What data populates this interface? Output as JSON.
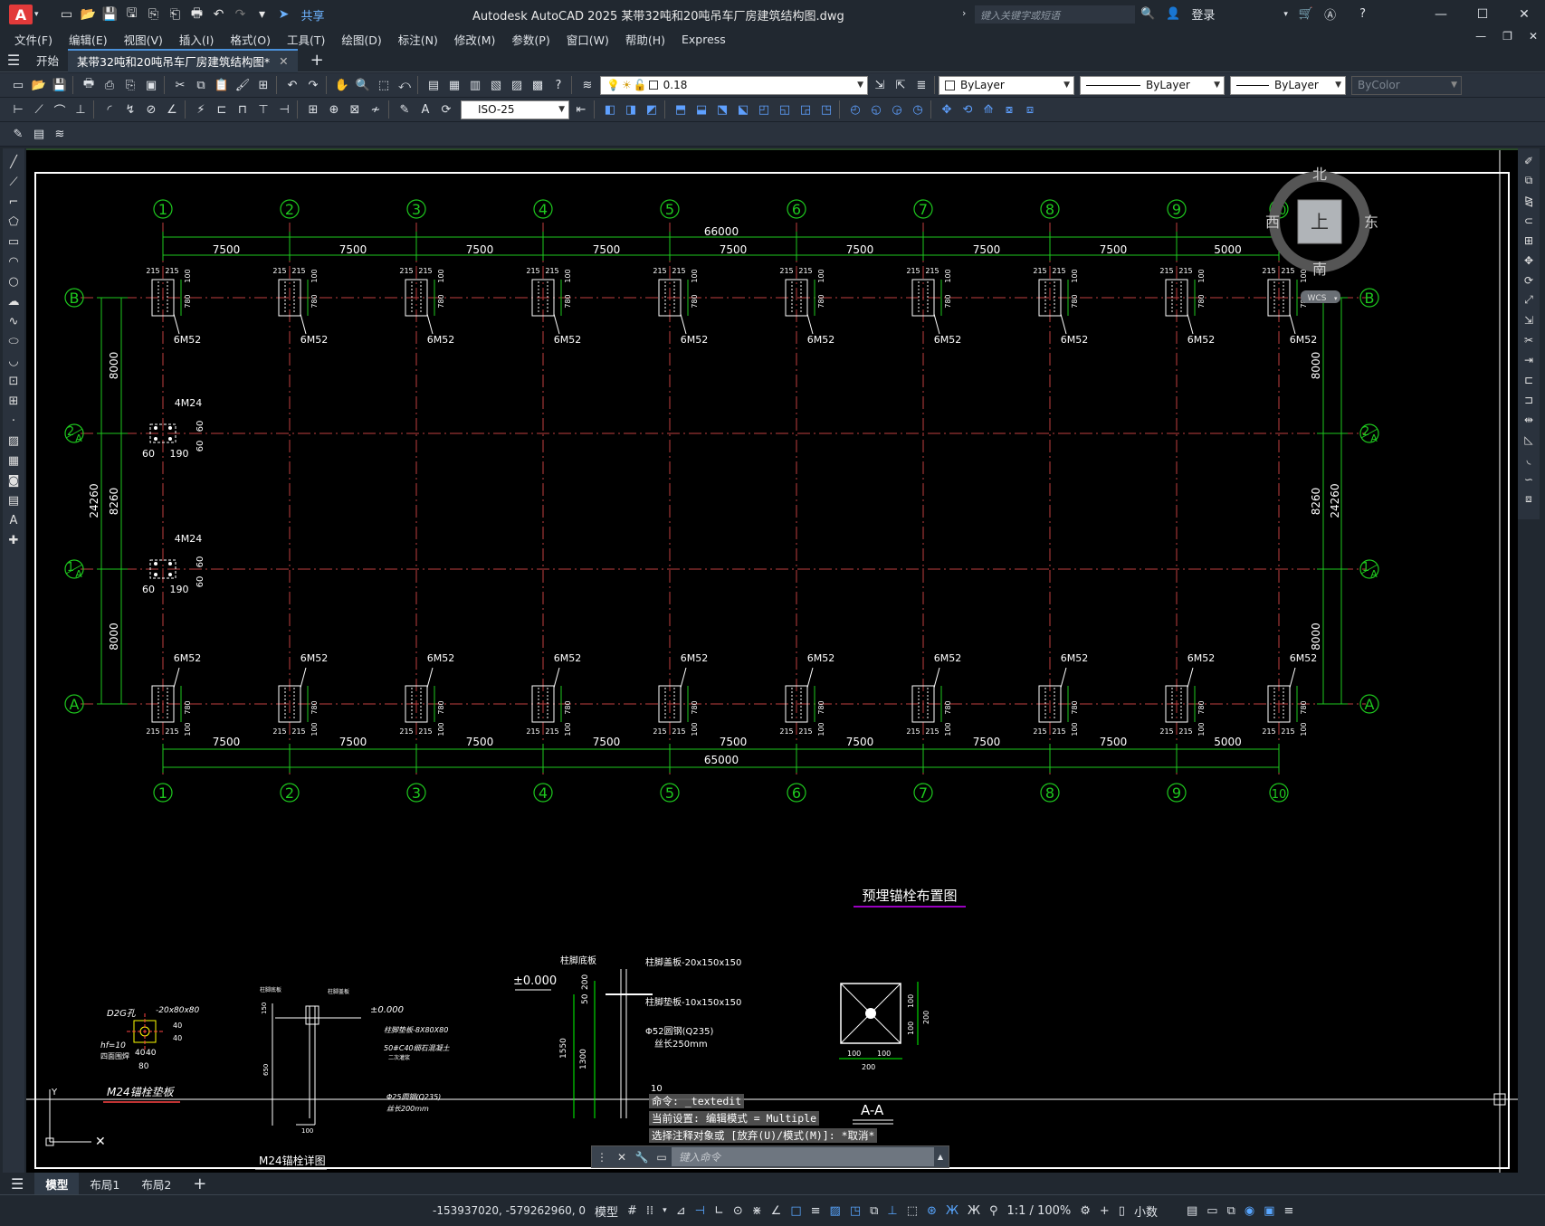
{
  "app": {
    "logo": "A",
    "title": "Autodesk AutoCAD 2025    某带32吨和20吨吊车厂房建筑结构图.dwg",
    "share_label": "共享",
    "search_placeholder": "键入关键字或短语",
    "login_label": "登录"
  },
  "menu": [
    "文件(F)",
    "编辑(E)",
    "视图(V)",
    "插入(I)",
    "格式(O)",
    "工具(T)",
    "绘图(D)",
    "标注(N)",
    "修改(M)",
    "参数(P)",
    "窗口(W)",
    "帮助(H)",
    "Express"
  ],
  "tabs": {
    "start": "开始",
    "doc": "某带32吨和20吨吊车厂房建筑结构图*"
  },
  "toolbar": {
    "layer_value": "0.18",
    "color": "ByLayer",
    "linetype": "ByLayer",
    "lineweight": "ByLayer",
    "plotstyle": "ByColor",
    "dimstyle": "ISO-25"
  },
  "viewcube": {
    "north": "北",
    "south": "南",
    "east": "东",
    "west": "西",
    "face": "上",
    "wcs": "WCS"
  },
  "drawing": {
    "grid_cols": [
      "1",
      "2",
      "3",
      "4",
      "5",
      "6",
      "7",
      "8",
      "9",
      "10"
    ],
    "top_total": "66000",
    "bottom_total": "65000",
    "span": "7500",
    "last_span": "5000",
    "row_B": "B",
    "row_2A": "2",
    "row_1A": "1",
    "row_A": "A",
    "row_sub": "A",
    "dim_8000": "8000",
    "dim_8260": "8260",
    "dim_24260": "24260",
    "bolt_6M52": "6M52",
    "bolt_4M24": "4M24",
    "d215": "215",
    "d100": "100",
    "d780": "780",
    "d60": "60",
    "d190": "190",
    "plan_title": "预埋锚栓布置图",
    "detail1_title": "M24锚栓垫板",
    "detail2_title": "M24锚栓详图",
    "section_title": "A-A",
    "elev": "±0.000",
    "lbl_base": "柱脚底板",
    "lbl_cap": "柱脚盖板-20x150x150",
    "lbl_pad": "柱脚垫板-10x150x150",
    "lbl_rod": "Φ52圆钢(Q235)",
    "lbl_len": "丝长250mm",
    "d1550": "1550",
    "d1300": "1300",
    "d50": "50",
    "d200": "200",
    "d10": "10",
    "d2g": "D2G孔",
    "d20x80": "-20x80x80",
    "hf10": "hf=10",
    "hf_note": "四面围焊",
    "d40": "40",
    "d80": "80",
    "d_elev2": "±0.000",
    "d_pad2": "柱脚垫板-8X80X80",
    "d_grout": "50#C40细石混凝土",
    "d_grout2": "二次灌浆",
    "d_rod2": "Φ25圆钢(Q235)",
    "d_rod2b": "丝长200mm",
    "d150": "150",
    "d650": "650",
    "d_nut": "柱脚底板",
    "d_nut2": "柱脚盖板"
  },
  "command": {
    "hist1": "命令: _textedit",
    "hist2": "当前设置: 编辑模式 = Multiple",
    "hist3": "选择注释对象或 [放弃(U)/模式(M)]: *取消*",
    "placeholder": "键入命令"
  },
  "layouts": [
    "模型",
    "布局1",
    "布局2"
  ],
  "status": {
    "coords": "-153937020, -579262960, 0",
    "model": "模型",
    "scale": "1:1 / 100%",
    "units": "小数"
  }
}
